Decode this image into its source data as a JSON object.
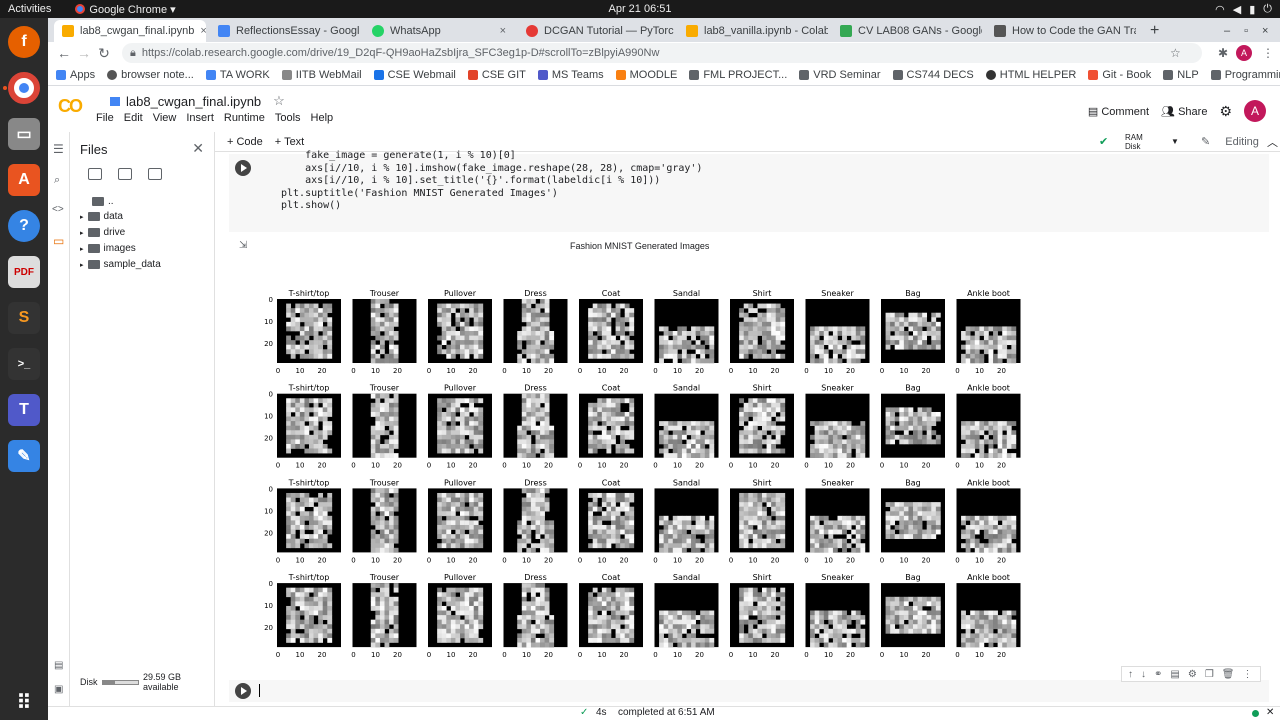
{
  "system": {
    "activities": "Activities",
    "app_name": "Google Chrome ▾",
    "clock": "Apr 21  06:51"
  },
  "tabs": [
    {
      "label": "lab8_cwgan_final.ipynb",
      "color": "#f9ab00"
    },
    {
      "label": "ReflectionsEssay - Google",
      "color": "#4285f4"
    },
    {
      "label": "WhatsApp",
      "color": "#25d366"
    },
    {
      "label": "DCGAN Tutorial — PyTorch",
      "color": "#e53935"
    },
    {
      "label": "lab8_vanilla.ipynb - Colab",
      "color": "#f9ab00"
    },
    {
      "label": "CV LAB08 GANs - Google",
      "color": "#34a853"
    },
    {
      "label": "How to Code the GAN Tra",
      "color": "#555555"
    }
  ],
  "url": "https://colab.research.google.com/drive/19_D2qF-QH9aoHaZsbIjra_SFC3eg1p-D#scrollTo=zBlpyiA990Nw",
  "bookmarks": [
    "Apps",
    "browser note...",
    "TA WORK",
    "IITB WebMail",
    "CSE Webmail",
    "CSE GIT",
    "MS Teams",
    "MOODLE",
    "FML PROJECT...",
    "VRD Seminar",
    "CS744 DECS",
    "HTML HELPER",
    "Git - Book",
    "NLP",
    "Programming"
  ],
  "colab": {
    "logo": "CO",
    "notebook_title": "lab8_cwgan_final.ipynb",
    "menus": [
      "File",
      "Edit",
      "View",
      "Insert",
      "Runtime",
      "Tools",
      "Help"
    ],
    "comment": "Comment",
    "share": "Share",
    "avatar": "A",
    "add_code": "+ Code",
    "add_text": "+ Text",
    "ram": "RAM",
    "disk": "Disk",
    "editing": "Editing"
  },
  "files": {
    "title": "Files",
    "items": [
      "..",
      "data",
      "drive",
      "images",
      "sample_data"
    ],
    "disk_label": "Disk",
    "disk_avail": "29.59 GB available",
    "disk_used_fraction": 0.35
  },
  "code_lines": [
    "    fake_image = generate(1, i % 10)[0]",
    "    axs[i//10, i % 10].imshow(fake_image.reshape(28, 28), cmap='gray')",
    "    axs[i//10, i % 10].set_title('{}'.format(labeldic[i % 10]))",
    "plt.suptitle('Fashion MNIST Generated Images')",
    "plt.show()"
  ],
  "chart_data": {
    "type": "image-grid",
    "title": "Fashion MNIST Generated Images",
    "rows": 4,
    "columns": [
      "T-shirt/top",
      "Trouser",
      "Pullover",
      "Dress",
      "Coat",
      "Sandal",
      "Shirt",
      "Sneaker",
      "Bag",
      "Ankle boot"
    ],
    "xticks": [
      "0",
      "10",
      "20"
    ],
    "yticks": [
      "0",
      "10",
      "20"
    ]
  },
  "status": {
    "time": "4s",
    "message": "completed at 6:51 AM"
  }
}
